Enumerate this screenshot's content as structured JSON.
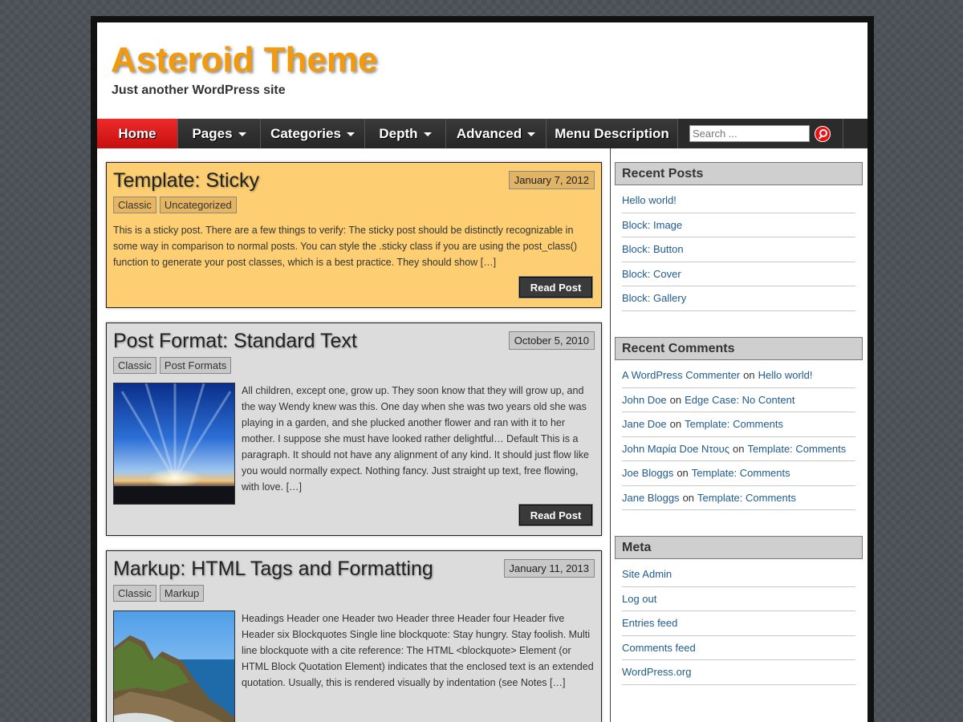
{
  "site": {
    "title": "Asteroid Theme",
    "description": "Just another WordPress site"
  },
  "nav": {
    "items": [
      {
        "label": "Home",
        "active": true,
        "dropdown": false
      },
      {
        "label": "Pages",
        "dropdown": true
      },
      {
        "label": "Categories",
        "dropdown": true
      },
      {
        "label": "Depth",
        "dropdown": true
      },
      {
        "label": "Advanced",
        "dropdown": true
      },
      {
        "label": "Menu Description",
        "dropdown": false
      }
    ],
    "search_placeholder": "Search ..."
  },
  "posts": [
    {
      "title": "Template: Sticky",
      "date": "January 7, 2012",
      "tags": [
        "Classic",
        "Uncategorized"
      ],
      "excerpt": "This is a sticky post. There are a few things to verify: The sticky post should be distinctly recognizable in some way in comparison to normal posts. You can style the .sticky class if you are using the post_class() function to generate your post classes, which is a best practice. They should show […]",
      "read_more": "Read Post"
    },
    {
      "title": "Post Format: Standard Text",
      "date": "October 5, 2010",
      "tags": [
        "Classic",
        "Post Formats"
      ],
      "excerpt": "All children, except one, grow up. They soon know that they will grow up, and the way Wendy knew was this. One day when she was two years old she was playing in a garden, and she plucked another flower and ran with it to her mother. I suppose she must have looked rather delightful… Default This is a paragraph. It should not have any alignment of any kind. It should just flow like you would normally expect. Nothing fancy. Just straight up text, free flowing, with love. […]",
      "read_more": "Read Post"
    },
    {
      "title": "Markup: HTML Tags and Formatting",
      "date": "January 11, 2013",
      "tags": [
        "Classic",
        "Markup"
      ],
      "excerpt": "Headings Header one Header two Header three Header four Header five Header six Blockquotes Single line blockquote: Stay hungry. Stay foolish. Multi line blockquote with a cite reference: The HTML <blockquote> Element (or HTML Block Quotation Element) indicates that the enclosed text is an extended quotation. Usually, this is rendered visually by indentation (see Notes […]"
    }
  ],
  "sidebar": {
    "recent_posts": {
      "title": "Recent Posts",
      "items": [
        "Hello world!",
        "Block: Image",
        "Block: Button",
        "Block: Cover",
        "Block: Gallery"
      ]
    },
    "recent_comments": {
      "title": "Recent Comments",
      "on": "on",
      "items": [
        {
          "author": "A WordPress Commenter",
          "post": "Hello world!"
        },
        {
          "author": "John Doe",
          "post": "Edge Case: No Content"
        },
        {
          "author": "Jane Doe",
          "post": "Template: Comments"
        },
        {
          "author": "John Μαρία Doe Ντους",
          "post": "Template: Comments"
        },
        {
          "author": "Joe Bloggs",
          "post": "Template: Comments"
        },
        {
          "author": "Jane Bloggs",
          "post": "Template: Comments"
        }
      ]
    },
    "meta": {
      "title": "Meta",
      "items": [
        "Site Admin",
        "Log out",
        "Entries feed",
        "Comments feed",
        "WordPress.org"
      ]
    }
  },
  "colors": {
    "accent": "#f29a0b",
    "nav_active": "#e11a1a",
    "sticky_bg": "#fdcf72",
    "link": "#1f5b8f"
  }
}
